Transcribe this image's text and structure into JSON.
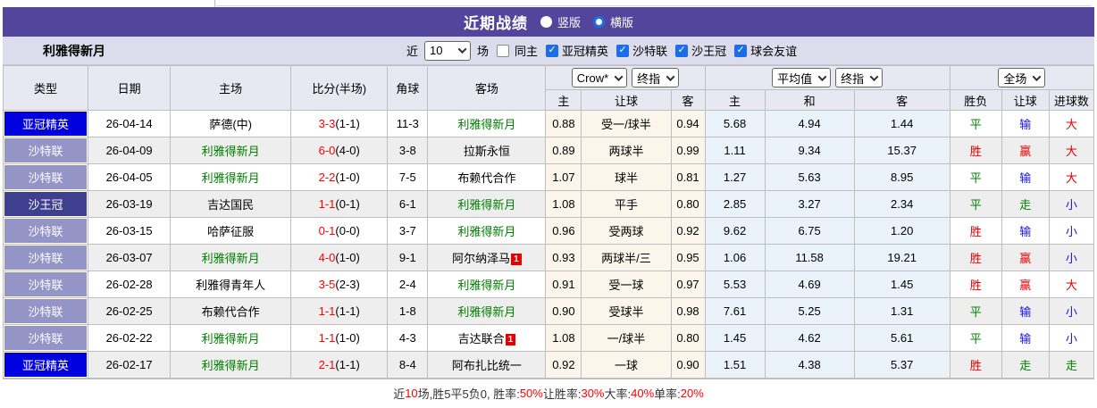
{
  "colors": {
    "title_bar_purple": "#52459B",
    "acl_badge_blue": "#0101DF",
    "saudi_league_badge": "#9494C6",
    "kings_cup_badge": "#3F3F8F",
    "self_team_green": "#008000",
    "score_red": "#FF0000",
    "result_red": "#E60000",
    "result_blue": "#1414E6",
    "checkbox_blue": "#1B6EE5",
    "handicap_group_bg": "#FBF5EB",
    "average_group_bg": "#EAF3FA"
  },
  "icons": {
    "check": "✓",
    "chevron_down": "chevron-down",
    "radio": "radio-circle"
  },
  "title_bar": {
    "title": "近期战绩",
    "view_options": [
      {
        "label": "竖版",
        "selected": false
      },
      {
        "label": "横版",
        "selected": true
      }
    ]
  },
  "filter_bar": {
    "team_name": "利雅得新月",
    "near_label": "近",
    "matches_select_value": "10",
    "matches_label": "场",
    "same_home": {
      "label": "同主",
      "checked": false
    },
    "league_filters": [
      {
        "label": "亚冠精英",
        "checked": true
      },
      {
        "label": "沙特联",
        "checked": true
      },
      {
        "label": "沙王冠",
        "checked": true
      },
      {
        "label": "球会友谊",
        "checked": true
      }
    ]
  },
  "table": {
    "selectors": {
      "odds_company": "Crow*",
      "odds_company_time": "终指",
      "average_type": "平均值",
      "average_time": "终指",
      "scope": "全场"
    },
    "columns": [
      "类型",
      "日期",
      "主场",
      "比分(半场)",
      "角球",
      "客场",
      "主",
      "让球",
      "客",
      "主",
      "和",
      "客",
      "胜负",
      "让球",
      "进球数"
    ],
    "rows": [
      {
        "type": "亚冠精英",
        "type_style": "acl",
        "date": "26-04-14",
        "home": "萨德(中)",
        "home_self": false,
        "home_card": "",
        "score": "3-3",
        "half": "(1-1)",
        "corner": "11-3",
        "away": "利雅得新月",
        "away_self": true,
        "away_card": "",
        "odds": [
          "0.88",
          "受一/球半",
          "0.94"
        ],
        "avg": [
          "5.68",
          "4.94",
          "1.44"
        ],
        "results": [
          {
            "t": "平",
            "c": "green"
          },
          {
            "t": "输",
            "c": "blue"
          },
          {
            "t": "大",
            "c": "red"
          }
        ]
      },
      {
        "type": "沙特联",
        "type_style": "saudi",
        "date": "26-04-09",
        "home": "利雅得新月",
        "home_self": true,
        "home_card": "",
        "score": "6-0",
        "half": "(4-0)",
        "corner": "3-8",
        "away": "拉斯永恒",
        "away_self": false,
        "away_card": "",
        "odds": [
          "0.89",
          "两球半",
          "0.99"
        ],
        "avg": [
          "1.11",
          "9.34",
          "15.37"
        ],
        "results": [
          {
            "t": "胜",
            "c": "red"
          },
          {
            "t": "赢",
            "c": "red"
          },
          {
            "t": "大",
            "c": "red"
          }
        ]
      },
      {
        "type": "沙特联",
        "type_style": "saudi",
        "date": "26-04-05",
        "home": "利雅得新月",
        "home_self": true,
        "home_card": "",
        "score": "2-2",
        "half": "(1-0)",
        "corner": "7-5",
        "away": "布赖代合作",
        "away_self": false,
        "away_card": "",
        "odds": [
          "1.07",
          "球半",
          "0.81"
        ],
        "avg": [
          "1.27",
          "5.63",
          "8.95"
        ],
        "results": [
          {
            "t": "平",
            "c": "green"
          },
          {
            "t": "输",
            "c": "blue"
          },
          {
            "t": "大",
            "c": "red"
          }
        ]
      },
      {
        "type": "沙王冠",
        "type_style": "kings",
        "date": "26-03-19",
        "home": "吉达国民",
        "home_self": false,
        "home_card": "",
        "score": "1-1",
        "half": "(0-1)",
        "corner": "6-1",
        "away": "利雅得新月",
        "away_self": true,
        "away_card": "",
        "odds": [
          "1.08",
          "平手",
          "0.80"
        ],
        "avg": [
          "2.85",
          "3.27",
          "2.34"
        ],
        "results": [
          {
            "t": "平",
            "c": "green"
          },
          {
            "t": "走",
            "c": "green"
          },
          {
            "t": "小",
            "c": "blue"
          }
        ]
      },
      {
        "type": "沙特联",
        "type_style": "saudi",
        "date": "26-03-15",
        "home": "哈萨征服",
        "home_self": false,
        "home_card": "",
        "score": "0-1",
        "half": "(0-0)",
        "corner": "3-7",
        "away": "利雅得新月",
        "away_self": true,
        "away_card": "",
        "odds": [
          "0.96",
          "受两球",
          "0.92"
        ],
        "avg": [
          "9.62",
          "6.75",
          "1.20"
        ],
        "results": [
          {
            "t": "胜",
            "c": "red"
          },
          {
            "t": "输",
            "c": "blue"
          },
          {
            "t": "小",
            "c": "blue"
          }
        ]
      },
      {
        "type": "沙特联",
        "type_style": "saudi",
        "date": "26-03-07",
        "home": "利雅得新月",
        "home_self": true,
        "home_card": "",
        "score": "4-0",
        "half": "(1-0)",
        "corner": "9-1",
        "away": "阿尔纳泽马",
        "away_self": false,
        "away_card": "1",
        "odds": [
          "0.93",
          "两球半/三",
          "0.95"
        ],
        "avg": [
          "1.06",
          "11.58",
          "19.21"
        ],
        "results": [
          {
            "t": "胜",
            "c": "red"
          },
          {
            "t": "赢",
            "c": "red"
          },
          {
            "t": "小",
            "c": "blue"
          }
        ]
      },
      {
        "type": "沙特联",
        "type_style": "saudi",
        "date": "26-02-28",
        "home": "利雅得青年人",
        "home_self": false,
        "home_card": "",
        "score": "3-5",
        "half": "(2-3)",
        "corner": "2-4",
        "away": "利雅得新月",
        "away_self": true,
        "away_card": "",
        "odds": [
          "0.91",
          "受一球",
          "0.97"
        ],
        "avg": [
          "5.53",
          "4.69",
          "1.45"
        ],
        "results": [
          {
            "t": "胜",
            "c": "red"
          },
          {
            "t": "赢",
            "c": "red"
          },
          {
            "t": "大",
            "c": "red"
          }
        ]
      },
      {
        "type": "沙特联",
        "type_style": "saudi",
        "date": "26-02-25",
        "home": "布赖代合作",
        "home_self": false,
        "home_card": "",
        "score": "1-1",
        "half": "(1-1)",
        "corner": "1-8",
        "away": "利雅得新月",
        "away_self": true,
        "away_card": "",
        "odds": [
          "0.90",
          "受球半",
          "0.98"
        ],
        "avg": [
          "7.61",
          "5.25",
          "1.31"
        ],
        "results": [
          {
            "t": "平",
            "c": "green"
          },
          {
            "t": "输",
            "c": "blue"
          },
          {
            "t": "小",
            "c": "blue"
          }
        ]
      },
      {
        "type": "沙特联",
        "type_style": "saudi",
        "date": "26-02-22",
        "home": "利雅得新月",
        "home_self": true,
        "home_card": "",
        "score": "1-1",
        "half": "(1-0)",
        "corner": "4-3",
        "away": "吉达联合",
        "away_self": false,
        "away_card": "1",
        "odds": [
          "1.08",
          "一/球半",
          "0.80"
        ],
        "avg": [
          "1.45",
          "4.62",
          "5.61"
        ],
        "results": [
          {
            "t": "平",
            "c": "green"
          },
          {
            "t": "输",
            "c": "blue"
          },
          {
            "t": "小",
            "c": "blue"
          }
        ]
      },
      {
        "type": "亚冠精英",
        "type_style": "acl",
        "date": "26-02-17",
        "home": "利雅得新月",
        "home_self": true,
        "home_card": "",
        "score": "2-1",
        "half": "(1-1)",
        "corner": "8-4",
        "away": "阿布扎比统一",
        "away_self": false,
        "away_card": "",
        "odds": [
          "0.92",
          "一球",
          "0.90"
        ],
        "avg": [
          "1.51",
          "4.38",
          "5.37"
        ],
        "results": [
          {
            "t": "胜",
            "c": "red"
          },
          {
            "t": "走",
            "c": "green"
          },
          {
            "t": "走",
            "c": "green"
          }
        ]
      }
    ]
  },
  "footer": {
    "segments": [
      {
        "text": "近",
        "c": "black"
      },
      {
        "text": "10",
        "c": "red"
      },
      {
        "text": "场,胜5平5负0, 胜率:",
        "c": "black"
      },
      {
        "text": "50%",
        "c": "red"
      },
      {
        "text": " 让胜率:",
        "c": "black"
      },
      {
        "text": "30%",
        "c": "red"
      },
      {
        "text": " 大率:",
        "c": "black"
      },
      {
        "text": "40%",
        "c": "red"
      },
      {
        "text": " 单率:",
        "c": "black"
      },
      {
        "text": "20%",
        "c": "red"
      }
    ]
  }
}
